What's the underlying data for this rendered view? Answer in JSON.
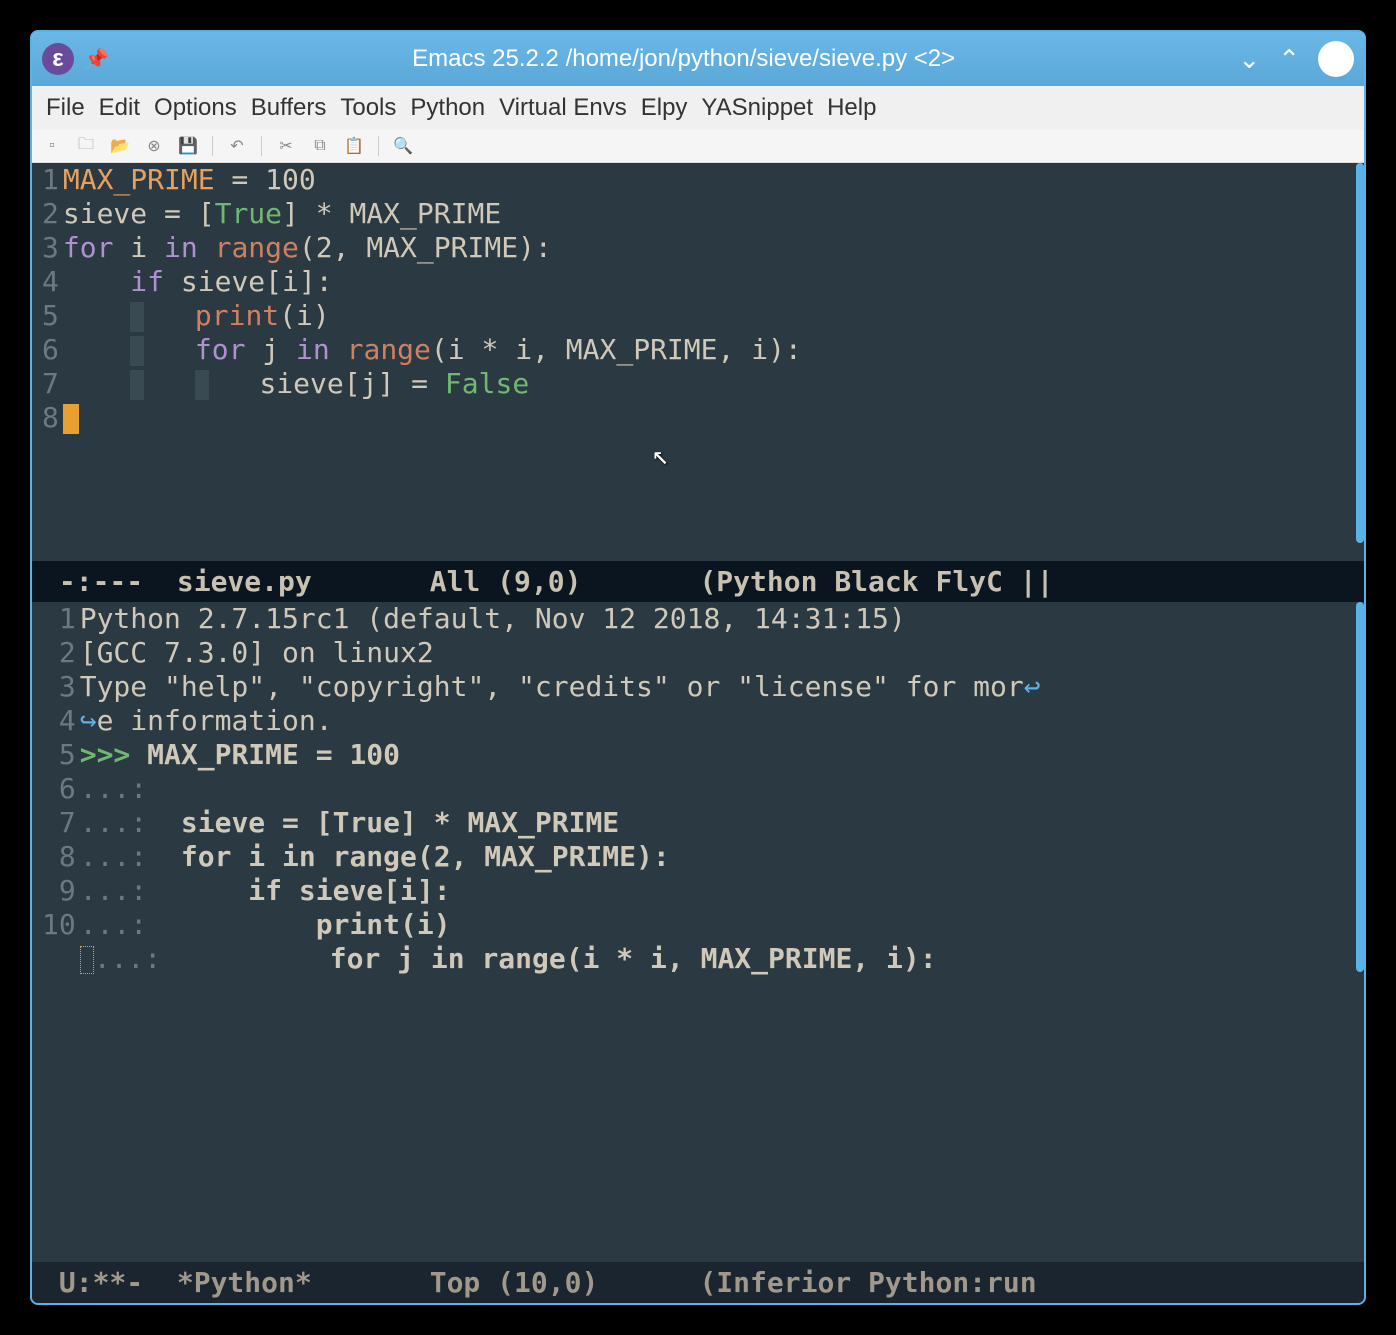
{
  "titlebar": {
    "title": "Emacs 25.2.2 /home/jon/python/sieve/sieve.py <2>"
  },
  "menubar": [
    "File",
    "Edit",
    "Options",
    "Buffers",
    "Tools",
    "Python",
    "Virtual Envs",
    "Elpy",
    "YASnippet",
    "Help"
  ],
  "toolbar_icons": [
    "new-file",
    "open-dir",
    "open-folder",
    "close-red",
    "save",
    "sep",
    "undo",
    "sep",
    "cut",
    "copy",
    "paste",
    "sep",
    "search"
  ],
  "editor": {
    "lines": [
      {
        "n": "1",
        "tokens": [
          [
            "var",
            "MAX_PRIME"
          ],
          [
            "op",
            " = "
          ],
          [
            "num",
            "100"
          ]
        ]
      },
      {
        "n": "2",
        "tokens": []
      },
      {
        "n": "3",
        "tokens": [
          [
            "default",
            "sieve "
          ],
          [
            "op",
            "= ["
          ],
          [
            "bool",
            "True"
          ],
          [
            "op",
            "] * "
          ],
          [
            "default",
            "MAX_PRIME"
          ]
        ]
      },
      {
        "n": "4",
        "tokens": [
          [
            "kw",
            "for"
          ],
          [
            "default",
            " i "
          ],
          [
            "kw",
            "in"
          ],
          [
            "default",
            " "
          ],
          [
            "builtin",
            "range"
          ],
          [
            "op",
            "("
          ],
          [
            "num",
            "2"
          ],
          [
            "op",
            ", "
          ],
          [
            "default",
            "MAX_PRIME"
          ],
          [
            "op",
            "):"
          ]
        ]
      },
      {
        "n": "5",
        "tokens": [
          [
            "default",
            "    "
          ],
          [
            "kw",
            "if"
          ],
          [
            "default",
            " sieve[i]:"
          ]
        ]
      },
      {
        "n": "6",
        "tokens": [
          [
            "default",
            "    "
          ],
          [
            "guide",
            ""
          ],
          [
            "default",
            "   "
          ],
          [
            "builtin",
            "print"
          ],
          [
            "op",
            "("
          ],
          [
            "default",
            "i"
          ],
          [
            "op",
            ")"
          ]
        ]
      },
      {
        "n": "7",
        "tokens": [
          [
            "default",
            "    "
          ],
          [
            "guide",
            ""
          ],
          [
            "default",
            "   "
          ],
          [
            "kw",
            "for"
          ],
          [
            "default",
            " j "
          ],
          [
            "kw",
            "in"
          ],
          [
            "default",
            " "
          ],
          [
            "builtin",
            "range"
          ],
          [
            "op",
            "("
          ],
          [
            "default",
            "i "
          ],
          [
            "op",
            "* "
          ],
          [
            "default",
            "i"
          ],
          [
            "op",
            ", "
          ],
          [
            "default",
            "MAX_PRIME"
          ],
          [
            "op",
            ", "
          ],
          [
            "default",
            "i"
          ],
          [
            "op",
            "):"
          ]
        ]
      },
      {
        "n": "8",
        "tokens": [
          [
            "default",
            "    "
          ],
          [
            "guide",
            ""
          ],
          [
            "default",
            "   "
          ],
          [
            "guide",
            ""
          ],
          [
            "default",
            "   sieve[j] "
          ],
          [
            "op",
            "= "
          ],
          [
            "bool",
            "False"
          ]
        ]
      }
    ],
    "cursor_line": true
  },
  "modeline_top": {
    "left": " -:---  ",
    "buffer": "sieve.py",
    "pos": "       All (9,0)       ",
    "modes": "(Python Black FlyC ||"
  },
  "repl": {
    "lines": [
      {
        "n": " 1",
        "prefix": "",
        "text": "Python 2.7.15rc1 (default, Nov 12 2018, 14:31:15)"
      },
      {
        "n": " 2",
        "prefix": "",
        "text": "[GCC 7.3.0] on linux2"
      },
      {
        "n": " 3",
        "prefix": "",
        "text": "Type \"help\", \"copyright\", \"credits\" or \"license\" for mor",
        "wrap": true
      },
      {
        "n": "  ",
        "prefix": "wrap",
        "text": "e information."
      },
      {
        "n": " 4",
        "prefix": ">>>",
        "text": " MAX_PRIME = 100",
        "bold": true
      },
      {
        "n": " 5",
        "prefix": "...:",
        "text": ""
      },
      {
        "n": " 6",
        "prefix": "...:",
        "text": "  sieve = [True] * MAX_PRIME",
        "bold": true
      },
      {
        "n": " 7",
        "prefix": "...:",
        "text": "  for i in range(2, MAX_PRIME):",
        "bold": true
      },
      {
        "n": " 8",
        "prefix": "...:",
        "text": "      if sieve[i]:",
        "bold": true
      },
      {
        "n": " 9",
        "prefix": "...:",
        "text": "          print(i)",
        "bold": true
      },
      {
        "n": "10",
        "prefix": "...:",
        "text": "          for j in range(i * i, MAX_PRIME, i):",
        "bold": true,
        "cursor": true
      }
    ]
  },
  "modeline_bottom": {
    "left": " U:**-  ",
    "buffer": "*Python*",
    "pos": "       Top (10,0)      ",
    "modes": "(Inferior Python:run "
  }
}
